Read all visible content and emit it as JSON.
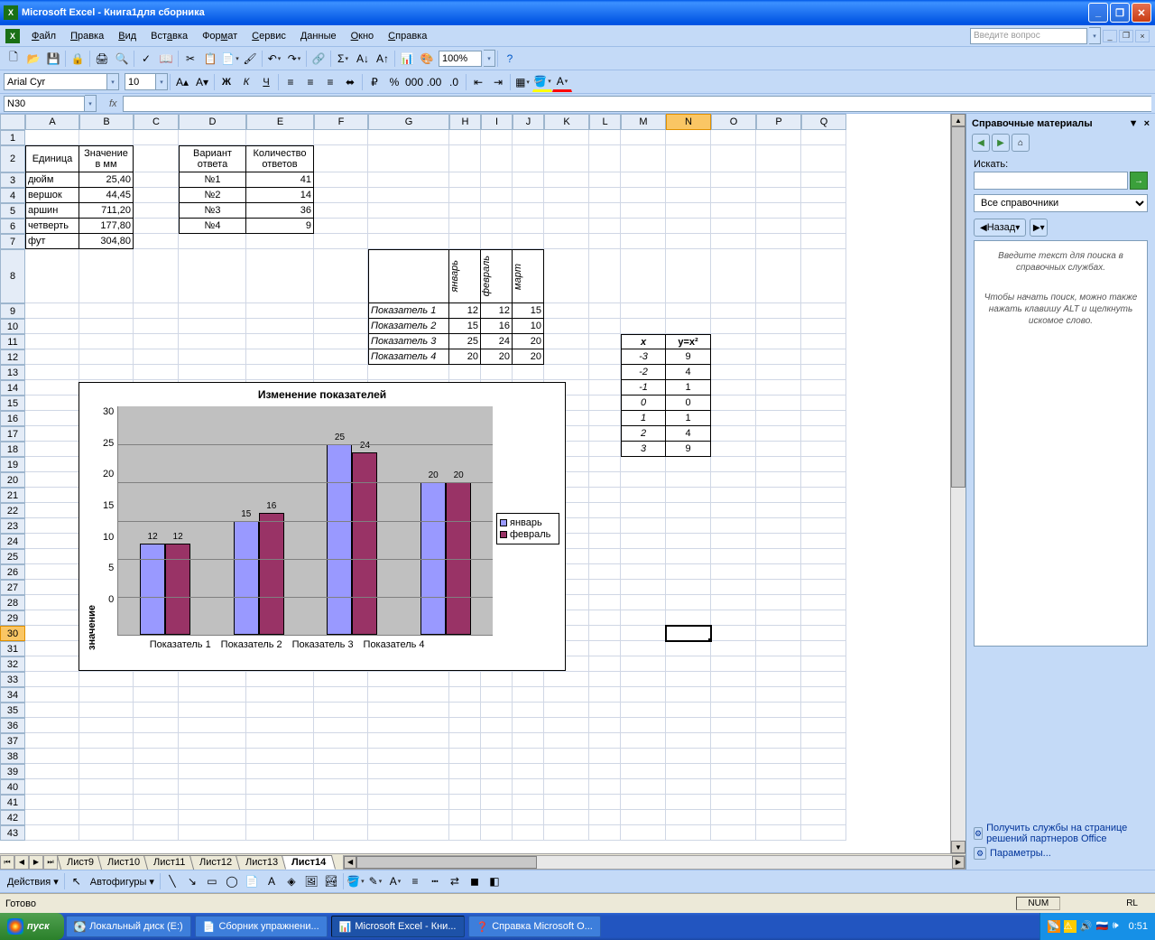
{
  "window": {
    "title": "Microsoft Excel - Книга1для сборника"
  },
  "menu": {
    "file": "Файл",
    "edit": "Правка",
    "view": "Вид",
    "insert": "Вставка",
    "format": "Формат",
    "tools": "Сервис",
    "data": "Данные",
    "window": "Окно",
    "help": "Справка",
    "ask_placeholder": "Введите вопрос"
  },
  "toolbar": {
    "zoom": "100%"
  },
  "format": {
    "font": "Arial Cyr",
    "size": "10"
  },
  "formula_bar": {
    "name_box": "N30",
    "fx": "fx"
  },
  "columns": [
    "A",
    "B",
    "C",
    "D",
    "E",
    "F",
    "G",
    "H",
    "I",
    "J",
    "K",
    "L",
    "M",
    "N",
    "O",
    "P",
    "Q"
  ],
  "table1": {
    "h1": "Единица",
    "h2": "Значение в мм",
    "rows": [
      {
        "a": "дюйм",
        "b": "25,40"
      },
      {
        "a": "вершок",
        "b": "44,45"
      },
      {
        "a": "аршин",
        "b": "711,20"
      },
      {
        "a": "четверть",
        "b": "177,80"
      },
      {
        "a": "фут",
        "b": "304,80"
      }
    ]
  },
  "table2": {
    "h1": "Вариант ответа",
    "h2": "Количество ответов",
    "rows": [
      {
        "d": "№1",
        "e": "41"
      },
      {
        "d": "№2",
        "e": "14"
      },
      {
        "d": "№3",
        "e": "36"
      },
      {
        "d": "№4",
        "e": "9"
      }
    ]
  },
  "table3": {
    "months": [
      "январь",
      "февраль",
      "март"
    ],
    "rows": [
      {
        "l": "Показатель 1",
        "v": [
          "12",
          "12",
          "15"
        ]
      },
      {
        "l": "Показатель 2",
        "v": [
          "15",
          "16",
          "10"
        ]
      },
      {
        "l": "Показатель 3",
        "v": [
          "25",
          "24",
          "20"
        ]
      },
      {
        "l": "Показатель 4",
        "v": [
          "20",
          "20",
          "20"
        ]
      }
    ]
  },
  "table4": {
    "hx": "x",
    "hy": "y=x²",
    "rows": [
      {
        "x": "-3",
        "y": "9"
      },
      {
        "x": "-2",
        "y": "4"
      },
      {
        "x": "-1",
        "y": "1"
      },
      {
        "x": "0",
        "y": "0"
      },
      {
        "x": "1",
        "y": "1"
      },
      {
        "x": "2",
        "y": "4"
      },
      {
        "x": "3",
        "y": "9"
      }
    ]
  },
  "chart_data": {
    "type": "bar",
    "title": "Изменение показателей",
    "ylabel": "значение",
    "categories": [
      "Показатель 1",
      "Показатель 2",
      "Показатель 3",
      "Показатель 4"
    ],
    "series": [
      {
        "name": "январь",
        "values": [
          12,
          15,
          25,
          20
        ]
      },
      {
        "name": "февраль",
        "values": [
          12,
          16,
          24,
          20
        ]
      }
    ],
    "ylim": [
      0,
      30
    ],
    "yticks": [
      0,
      5,
      10,
      15,
      20,
      25,
      30
    ]
  },
  "sheets": {
    "tabs": [
      "Лист9",
      "Лист10",
      "Лист11",
      "Лист12",
      "Лист13",
      "Лист14"
    ],
    "active": "Лист14"
  },
  "drawbar": {
    "actions": "Действия",
    "autoshapes": "Автофигуры"
  },
  "status": {
    "ready": "Готово",
    "num": "NUM",
    "lang": "RL"
  },
  "taskpane": {
    "title": "Справочные материалы",
    "search_label": "Искать:",
    "source": "Все справочники",
    "back": "Назад",
    "hint1": "Введите текст для поиска в справочных службах.",
    "hint2": "Чтобы начать поиск, можно также нажать клавишу ALT и щелкнуть искомое слово.",
    "link1": "Получить службы на странице решений партнеров Office",
    "link2": "Параметры..."
  },
  "taskbar": {
    "start": "пуск",
    "items": [
      "Локальный диск (E:)",
      "Сборник упражнени...",
      "Microsoft Excel - Кни...",
      "Справка Microsoft O..."
    ],
    "clock": "0:51"
  }
}
